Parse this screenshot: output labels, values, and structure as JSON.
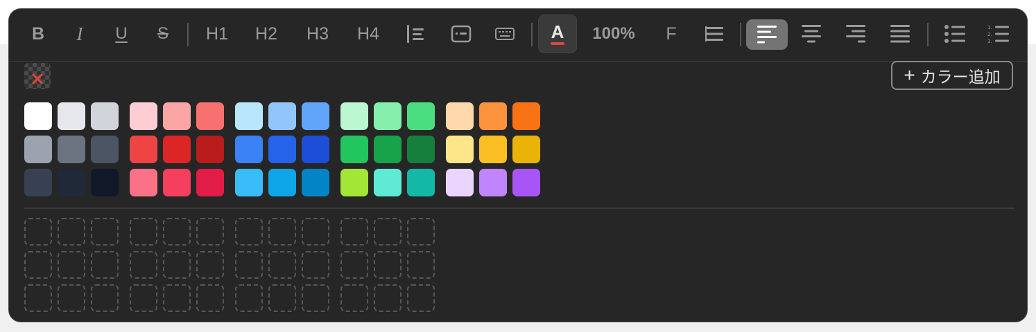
{
  "toolbar": {
    "bold": "B",
    "italic": "I",
    "underline": "U",
    "strike": "S",
    "h1": "H1",
    "h2": "H2",
    "h3": "H3",
    "h4": "H4",
    "zoom": "100%",
    "font": "F",
    "text_color_letter": "A",
    "text_color_accent": "#e0453d",
    "active_align_bg": "#747474"
  },
  "palette": {
    "add_color_label": "カラー追加",
    "add_color_icon": "plus-icon",
    "no_color_icon": "clear-color-icon",
    "colors": [
      [
        "#ffffff",
        "#e5e7eb",
        "#d1d5db",
        "#fecdd3",
        "#fca5a5",
        "#f87171",
        "#bae6fd",
        "#93c5fd",
        "#60a5fa",
        "#bbf7d0",
        "#86efac",
        "#4ade80",
        "#fed7aa",
        "#fb923c",
        "#f97316"
      ],
      [
        "#9ca3af",
        "#6b7280",
        "#4b5563",
        "#ef4444",
        "#dc2626",
        "#b91c1c",
        "#3b82f6",
        "#2563eb",
        "#1d4ed8",
        "#22c55e",
        "#16a34a",
        "#15803d",
        "#fde68a",
        "#fbbf24",
        "#eab308"
      ],
      [
        "#374151",
        "#1f2937",
        "#111827",
        "#fb7185",
        "#f43f5e",
        "#e11d48",
        "#38bdf8",
        "#0ea5e9",
        "#0284c7",
        "#a3e635",
        "#5eead4",
        "#14b8a6",
        "#e9d5ff",
        "#c084fc",
        "#a855f7"
      ]
    ],
    "custom_slot_rows": 3,
    "custom_slot_cols": 12
  }
}
